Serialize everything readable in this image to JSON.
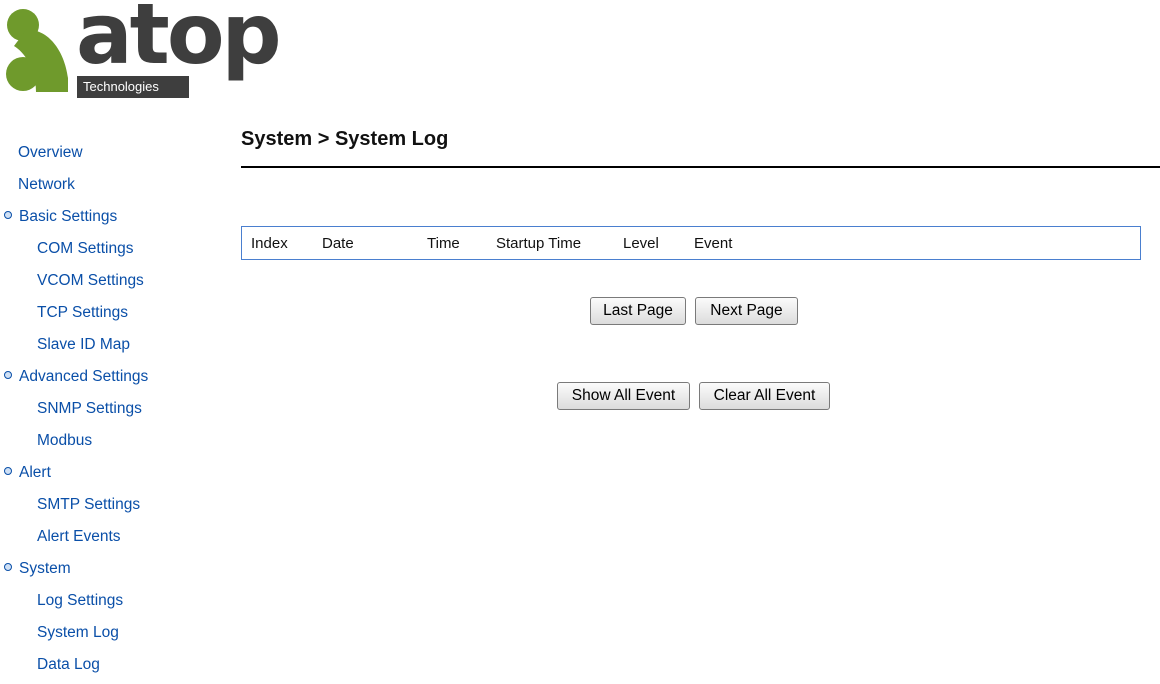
{
  "brand": {
    "logo_word": "atop",
    "logo_sub": "Technologies",
    "colors": {
      "logo_green": "#6f9a2c",
      "logo_text": "#3e3e3e"
    }
  },
  "sidebar": {
    "items": [
      {
        "label": "Overview"
      },
      {
        "label": "Network"
      },
      {
        "label": "Basic Settings"
      },
      {
        "label": "COM Settings"
      },
      {
        "label": "VCOM Settings"
      },
      {
        "label": "TCP Settings"
      },
      {
        "label": "Slave ID Map"
      },
      {
        "label": "Advanced Settings"
      },
      {
        "label": "SNMP Settings"
      },
      {
        "label": "Modbus"
      },
      {
        "label": "Alert"
      },
      {
        "label": "SMTP Settings"
      },
      {
        "label": "Alert Events"
      },
      {
        "label": "System"
      },
      {
        "label": "Log Settings"
      },
      {
        "label": "System Log"
      },
      {
        "label": "Data Log"
      }
    ]
  },
  "main": {
    "title": "System > System Log",
    "table": {
      "columns": [
        "Index",
        "Date",
        "Time",
        "Startup Time",
        "Level",
        "Event"
      ]
    },
    "buttons": {
      "last_page": "Last Page",
      "next_page": "Next Page",
      "show_all": "Show All Event",
      "clear_all": "Clear All Event"
    }
  },
  "theme": {
    "link_color": "#0a4fa8",
    "table_border": "#4a7fcf"
  }
}
